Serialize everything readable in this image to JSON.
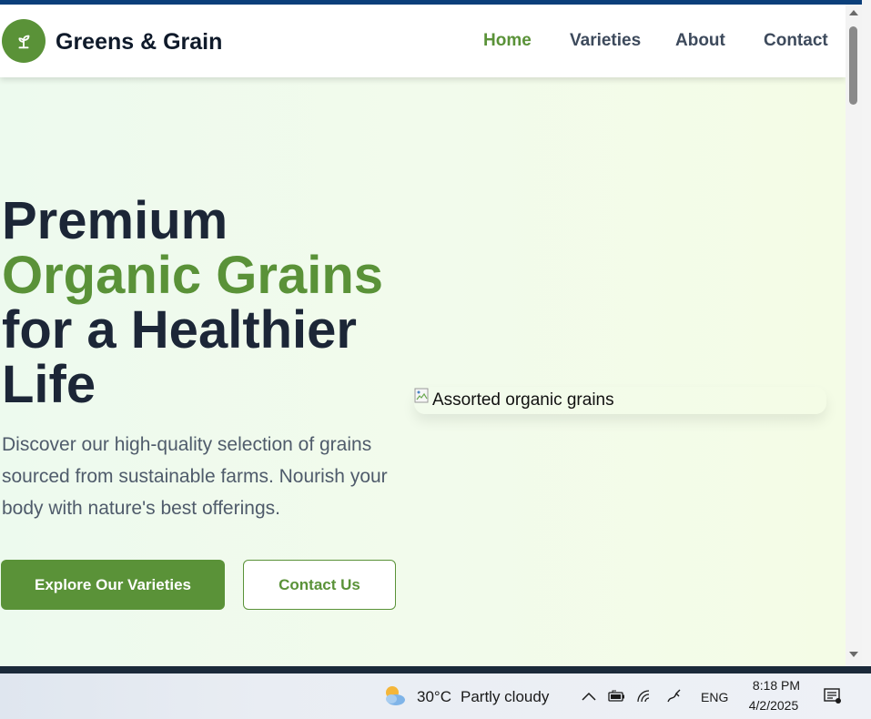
{
  "site": {
    "brand": "Greens & Grain",
    "logo_icon": "sprout-icon",
    "nav": [
      {
        "label": "Home",
        "active": true
      },
      {
        "label": "Varieties",
        "active": false
      },
      {
        "label": "About",
        "active": false
      },
      {
        "label": "Contact",
        "active": false
      }
    ]
  },
  "hero": {
    "title_line1": "Premium",
    "title_line2": "Organic Grains",
    "title_line3": "for a Healthier",
    "title_line4": "Life",
    "description": "Discover our high-quality selection of grains sourced from sustainable farms. Nourish your body with nature's best offerings.",
    "primary_button": "Explore Our Varieties",
    "secondary_button": "Contact Us",
    "image_alt": "Assorted organic grains"
  },
  "taskbar": {
    "weather_temp": "30°C",
    "weather_desc": "Partly cloudy",
    "language": "ENG",
    "time": "8:18 PM",
    "date": "4/2/2025"
  },
  "colors": {
    "accent": "#5a9238",
    "heading": "#1c2637",
    "body_text": "#4f5b6b",
    "window_border": "#0b3f7a"
  }
}
